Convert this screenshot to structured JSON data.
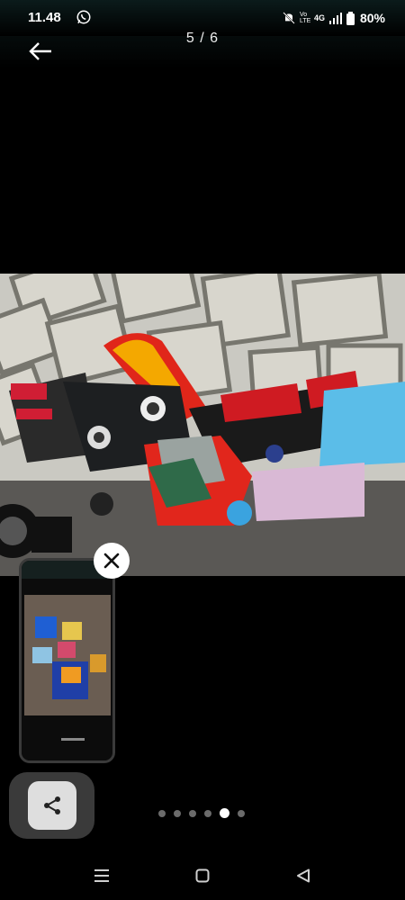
{
  "status_bar": {
    "time": "11.48",
    "network": "4G",
    "volte": "Vo LTE",
    "battery": "80%",
    "icons": [
      "whatsapp-icon",
      "mute-icon",
      "volte-icon",
      "signal-icon",
      "battery-icon"
    ]
  },
  "viewer": {
    "counter": "5 / 6",
    "current_index": 5,
    "total": 6
  },
  "pip": {
    "icons": [
      "close-icon"
    ]
  },
  "actions": {
    "icons": [
      "share-icon"
    ]
  },
  "pagination": {
    "count": 6,
    "active": 5
  },
  "nav_bar": {
    "icons": [
      "recents-icon",
      "home-icon",
      "back-icon"
    ]
  },
  "colors": {
    "background": "#000000",
    "status_bar": "#0b1b1b",
    "share_button": "#dedede",
    "active_dot": "#ffffff",
    "inactive_dot": "#6b6b6b"
  }
}
